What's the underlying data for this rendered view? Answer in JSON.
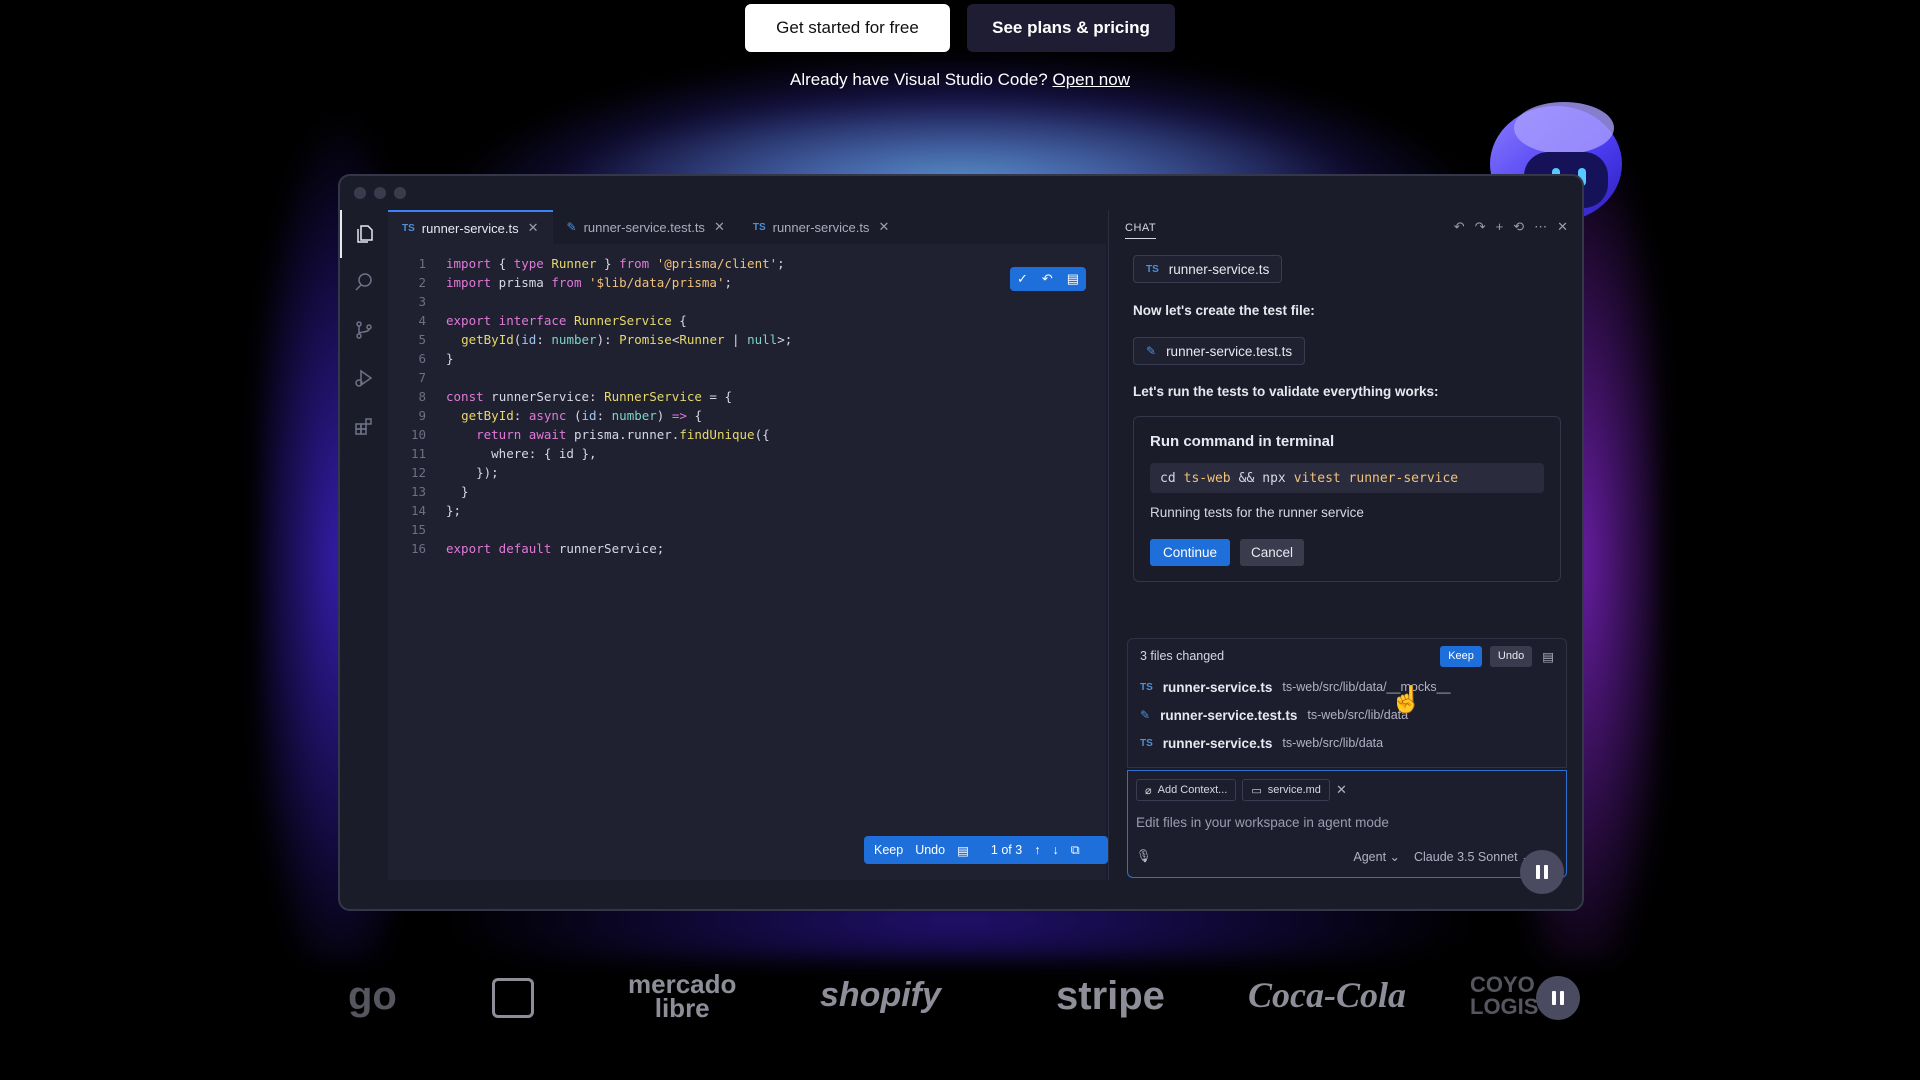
{
  "cta": {
    "primary_label": "Get started for free",
    "secondary_label": "See plans & pricing",
    "already_text": "Already have Visual Studio Code?",
    "open_now_label": "Open now"
  },
  "editor": {
    "tabs": [
      {
        "label": "runner-service.ts",
        "badge": "TS"
      },
      {
        "label": "runner-service.test.ts",
        "badge": ""
      },
      {
        "label": "runner-service.ts",
        "badge": "TS"
      }
    ],
    "line_numbers": [
      "1",
      "2",
      "3",
      "4",
      "5",
      "6",
      "7",
      "8",
      "9",
      "10",
      "11",
      "12",
      "13",
      "14",
      "15",
      "16"
    ],
    "toolbar": {
      "keep_label": "Keep",
      "undo_label": "Undo",
      "page_label": "1 of 3"
    }
  },
  "chat": {
    "title": "CHAT",
    "file_chip_1": {
      "badge": "TS",
      "label": "runner-service.ts"
    },
    "message_1": "Now let's create the test file:",
    "file_chip_2": {
      "label": "runner-service.test.ts"
    },
    "message_2": "Let's run the tests to validate everything works:",
    "command_card": {
      "title": "Run command in terminal",
      "cmd_1": "cd",
      "cmd_2": "ts-web",
      "cmd_3": "&&",
      "cmd_4": "npx",
      "cmd_5": "vitest runner-service",
      "description": "Running tests for the runner service",
      "continue_label": "Continue",
      "cancel_label": "Cancel"
    },
    "changes": {
      "summary": "3 files changed",
      "keep_label": "Keep",
      "undo_label": "Undo",
      "files": [
        {
          "badge": "TS",
          "name": "runner-service.ts",
          "path": "ts-web/src/lib/data/__mocks__"
        },
        {
          "badge": "",
          "name": "runner-service.test.ts",
          "path": "ts-web/src/lib/data"
        },
        {
          "badge": "TS",
          "name": "runner-service.ts",
          "path": "ts-web/src/lib/data"
        }
      ]
    },
    "input": {
      "add_context_label": "Add Context...",
      "context_file_label": "service.md",
      "placeholder": "Edit files in your workspace in agent mode",
      "mode_label": "Agent",
      "model_label": "Claude 3.5 Sonnet"
    }
  },
  "logos": {
    "go": "go",
    "mercado_1": "mercado",
    "mercado_2": "libre",
    "shopify": "shopify",
    "stripe": "stripe",
    "coca_cola": "Coca-Cola",
    "coyote_1": "COYO",
    "coyote_2": "LOGIS"
  },
  "colors": {
    "accent": "#1e6fd9",
    "window_bg": "#1b1c2a",
    "editor_bg": "#1f2030"
  }
}
